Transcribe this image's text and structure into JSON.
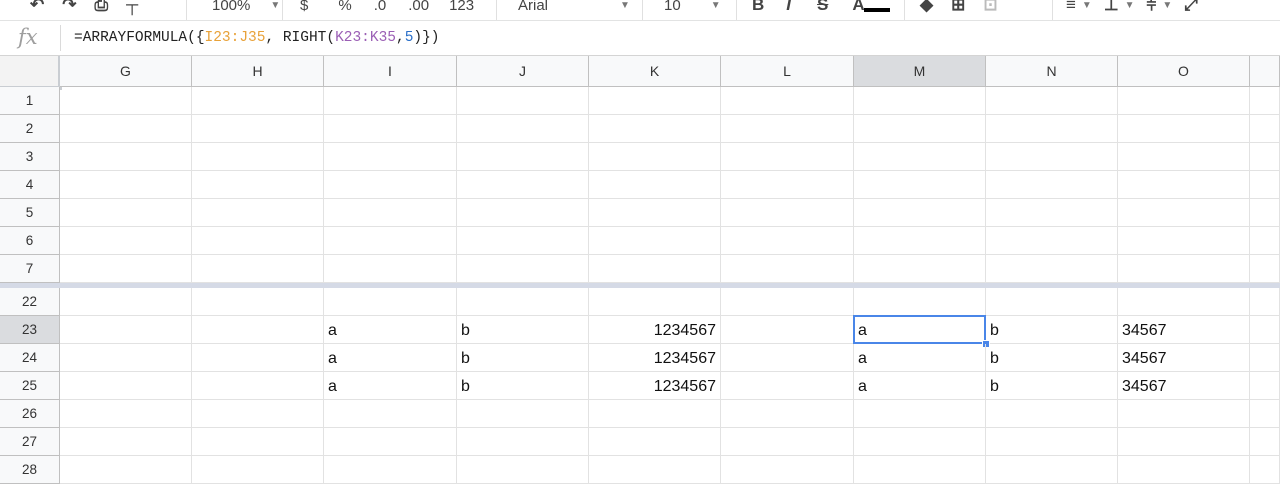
{
  "toolbar": {
    "zoom": "100%",
    "currency": "$",
    "percent": "%",
    "decrease_decimals": ".0",
    "increase_decimals": ".00",
    "more_formats": "123",
    "font": "Arial",
    "font_size": "10",
    "bold": "B",
    "italic": "I",
    "strikethrough": "S",
    "text_color": "A"
  },
  "formula_bar": {
    "fx_label": "fx",
    "formula_prefix": "=ARRAYFORMULA({",
    "range1": "I23:J35",
    "formula_mid": ", RIGHT(",
    "range2": "K23:K35",
    "formula_comma": ",",
    "num_arg": "5",
    "formula_suffix": ")})"
  },
  "columns": [
    "G",
    "H",
    "I",
    "J",
    "K",
    "L",
    "M",
    "N",
    "O"
  ],
  "active_column": "M",
  "rows": [
    {
      "n": "1",
      "cells": {}
    },
    {
      "n": "2",
      "cells": {}
    },
    {
      "n": "3",
      "cells": {}
    },
    {
      "n": "4",
      "cells": {}
    },
    {
      "n": "5",
      "cells": {}
    },
    {
      "n": "6",
      "cells": {}
    },
    {
      "n": "7",
      "cells": {}
    },
    {
      "n": "22",
      "cells": {}
    },
    {
      "n": "23",
      "cells": {
        "I": "a",
        "J": "b",
        "K": "1234567",
        "M": "a",
        "N": "b",
        "O": "34567"
      }
    },
    {
      "n": "24",
      "cells": {
        "I": "a",
        "J": "b",
        "K": "1234567",
        "M": "a",
        "N": "b",
        "O": "34567"
      }
    },
    {
      "n": "25",
      "cells": {
        "I": "a",
        "J": "b",
        "K": "1234567",
        "M": "a",
        "N": "b",
        "O": "34567"
      }
    },
    {
      "n": "26",
      "cells": {}
    },
    {
      "n": "27",
      "cells": {}
    },
    {
      "n": "28",
      "cells": {}
    }
  ],
  "active_row": "23",
  "numeric_columns": [
    "K"
  ],
  "colors": {
    "selection": "#4a86e8",
    "header_bg": "#f8f9fa",
    "header_active_bg": "#dadcdf",
    "freeze_line": "#d5dae6"
  }
}
